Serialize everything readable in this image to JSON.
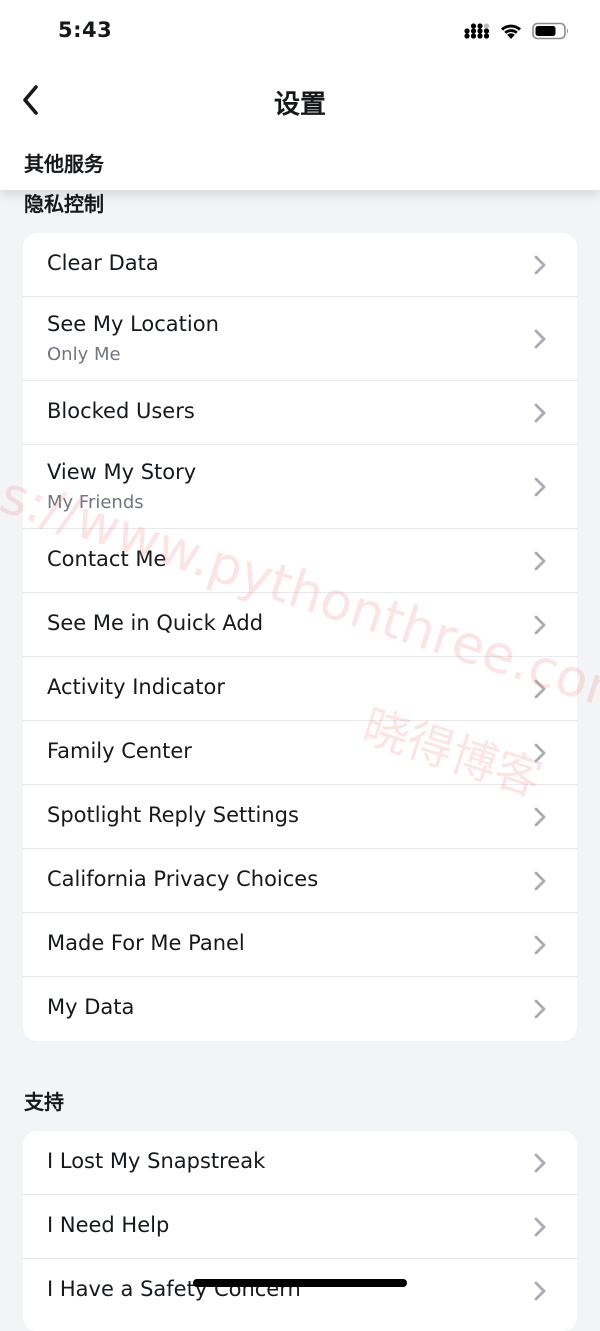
{
  "status_bar": {
    "time": "5:43"
  },
  "header": {
    "title": "设置",
    "back_icon": "chevron-left-icon"
  },
  "sticky_section": {
    "title": "其他服务"
  },
  "privacy": {
    "title": "隐私控制",
    "items": [
      {
        "label": "Clear Data"
      },
      {
        "label": "See My Location",
        "sub": "Only Me"
      },
      {
        "label": "Blocked Users"
      },
      {
        "label": "View My Story",
        "sub": "My Friends"
      },
      {
        "label": "Contact Me"
      },
      {
        "label": "See Me in Quick Add"
      },
      {
        "label": "Activity Indicator"
      },
      {
        "label": "Family Center"
      },
      {
        "label": "Spotlight Reply Settings"
      },
      {
        "label": "California Privacy Choices"
      },
      {
        "label": "Made For Me Panel"
      },
      {
        "label": "My Data"
      }
    ]
  },
  "support": {
    "title": "支持",
    "items": [
      {
        "label": "I Lost My Snapstreak"
      },
      {
        "label": "I Need Help"
      },
      {
        "label": "I Have a Safety Concern"
      }
    ]
  },
  "watermark": {
    "url": "ps://www.pythonthree.com",
    "name": "晓得博客"
  },
  "colors": {
    "background": "#f3f4f5",
    "card": "#ffffff",
    "text": "#16191c",
    "subtext": "#717580",
    "chevron": "#a9adb3"
  }
}
